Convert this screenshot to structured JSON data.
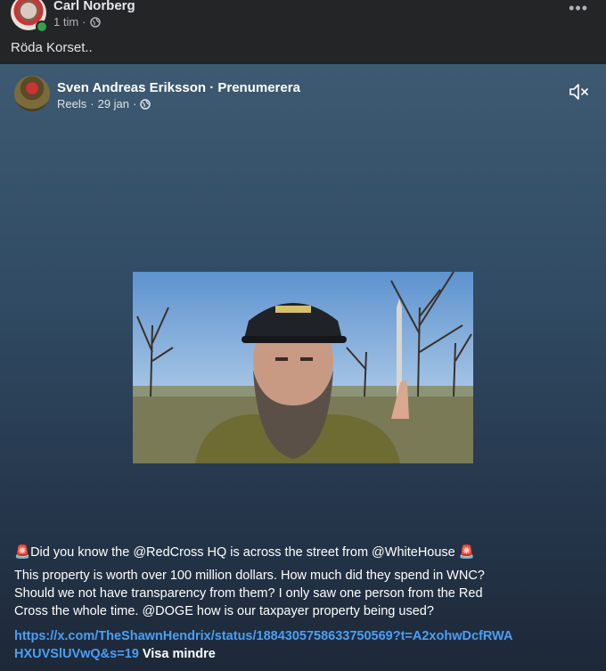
{
  "top_post": {
    "author": "Carl Norberg",
    "time": "1 tim",
    "separator": "·",
    "text": "Röda Korset..",
    "more_icon": "more-dots-icon"
  },
  "reel": {
    "author": "Sven Andreas Eriksson",
    "separator": "·",
    "subscribe_label": "Prenumerera",
    "category": "Reels",
    "date": "29 jan",
    "mute_icon": "speaker-muted-icon",
    "caption_line1": "Did you know the @RedCross HQ is across the street from @WhiteHouse",
    "caption_siren": "🚨",
    "caption_body": "This property is worth over 100 million dollars. How much did they spend in WNC? Should we not have transparency from them? I only saw one person from the Red Cross the whole time. @DOGE how is our taxpayer property being used?",
    "link_text": "https://x.com/TheShawnHendrix/status/1884305758633750569?t=A2xohwDcfRWAHXUVSlUVwQ&s=19",
    "show_less": "Visa mindre"
  },
  "colors": {
    "background": "#242526",
    "link": "#4a9ff5",
    "online": "#31a24c"
  }
}
